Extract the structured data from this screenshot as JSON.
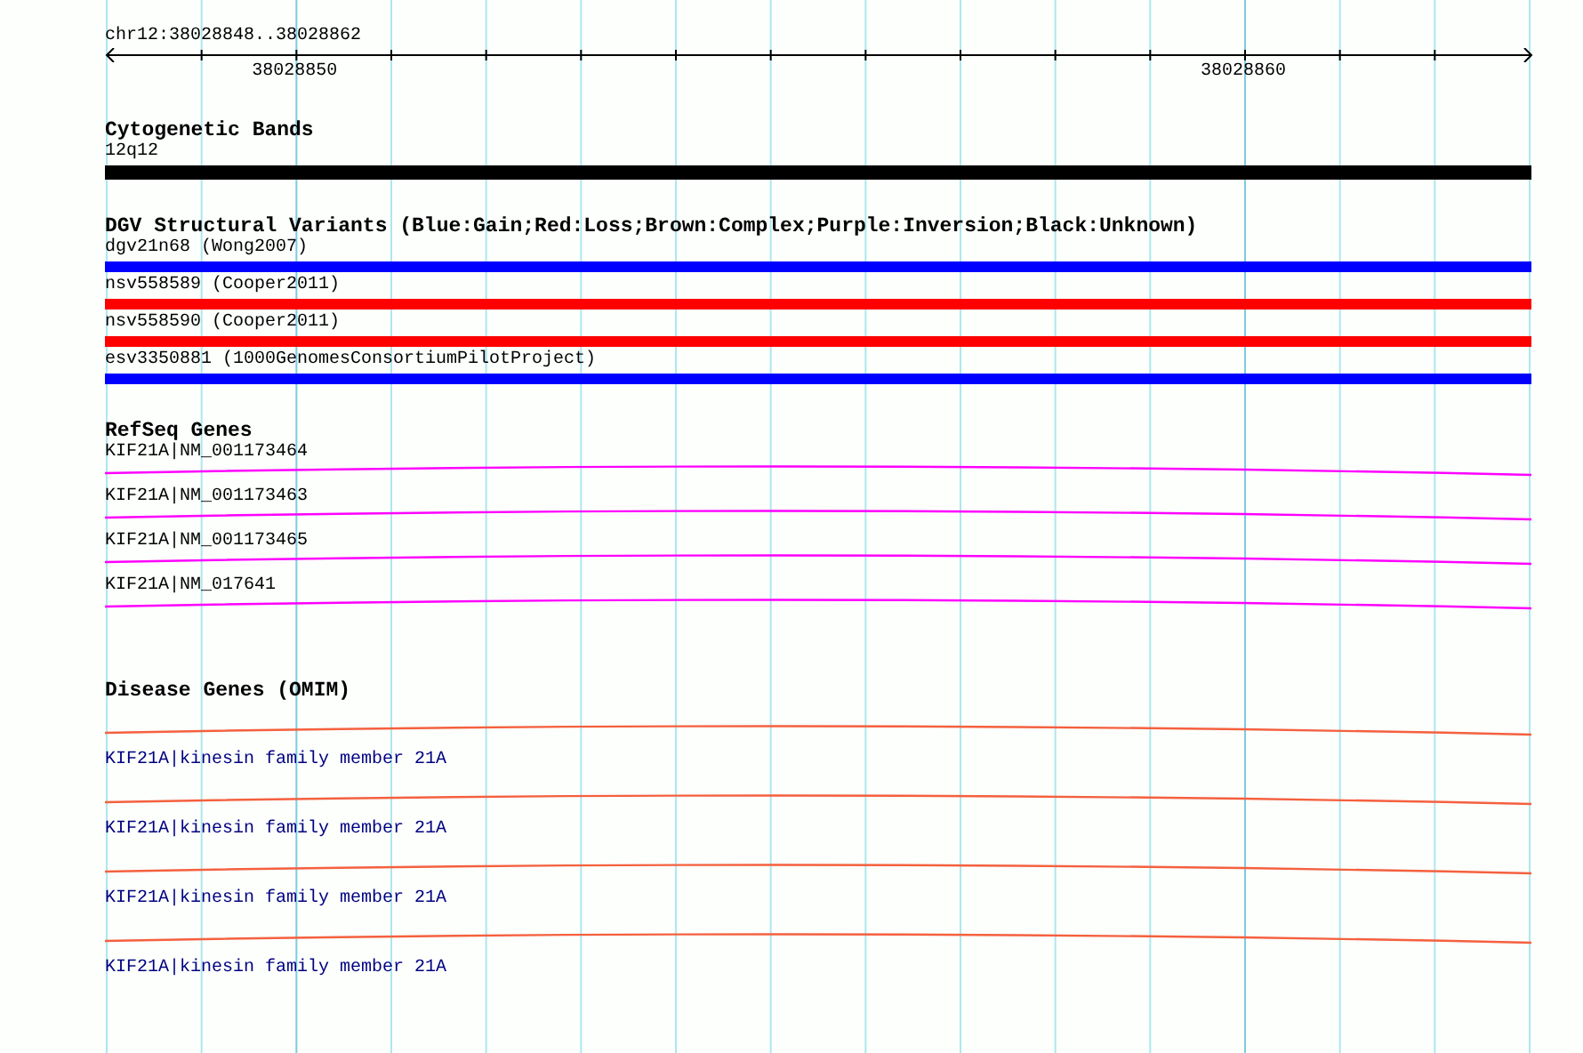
{
  "ruler": {
    "range": "chr12:38028848..38028862",
    "tick_labels": [
      "38028850",
      "38028860"
    ]
  },
  "tracks": [
    {
      "title": "Cytogenetic Bands",
      "kind": "band",
      "features": [
        {
          "label": "12q12",
          "color": "#000000"
        }
      ]
    },
    {
      "title": "DGV Structural Variants (Blue:Gain;Red:Loss;Brown:Complex;Purple:Inversion;Black:Unknown)",
      "kind": "variant",
      "features": [
        {
          "label": "dgv21n68 (Wong2007)",
          "color": "#0000ff"
        },
        {
          "label": "nsv558589 (Cooper2011)",
          "color": "#ff0000"
        },
        {
          "label": "nsv558590 (Cooper2011)",
          "color": "#ff0000"
        },
        {
          "label": "esv3350881 (1000GenomesConsortiumPilotProject)",
          "color": "#0000ff"
        }
      ]
    },
    {
      "title": "RefSeq Genes",
      "kind": "gene",
      "features": [
        {
          "label": "KIF21A|NM_001173464"
        },
        {
          "label": "KIF21A|NM_001173463"
        },
        {
          "label": "KIF21A|NM_001173465"
        },
        {
          "label": "KIF21A|NM_017641"
        }
      ]
    },
    {
      "title": "Disease Genes (OMIM)",
      "kind": "omim",
      "features": [
        {
          "label": "KIF21A|kinesin family member 21A"
        },
        {
          "label": "KIF21A|kinesin family member 21A"
        },
        {
          "label": "KIF21A|kinesin family member 21A"
        },
        {
          "label": "KIF21A|kinesin family member 21A"
        }
      ]
    }
  ]
}
